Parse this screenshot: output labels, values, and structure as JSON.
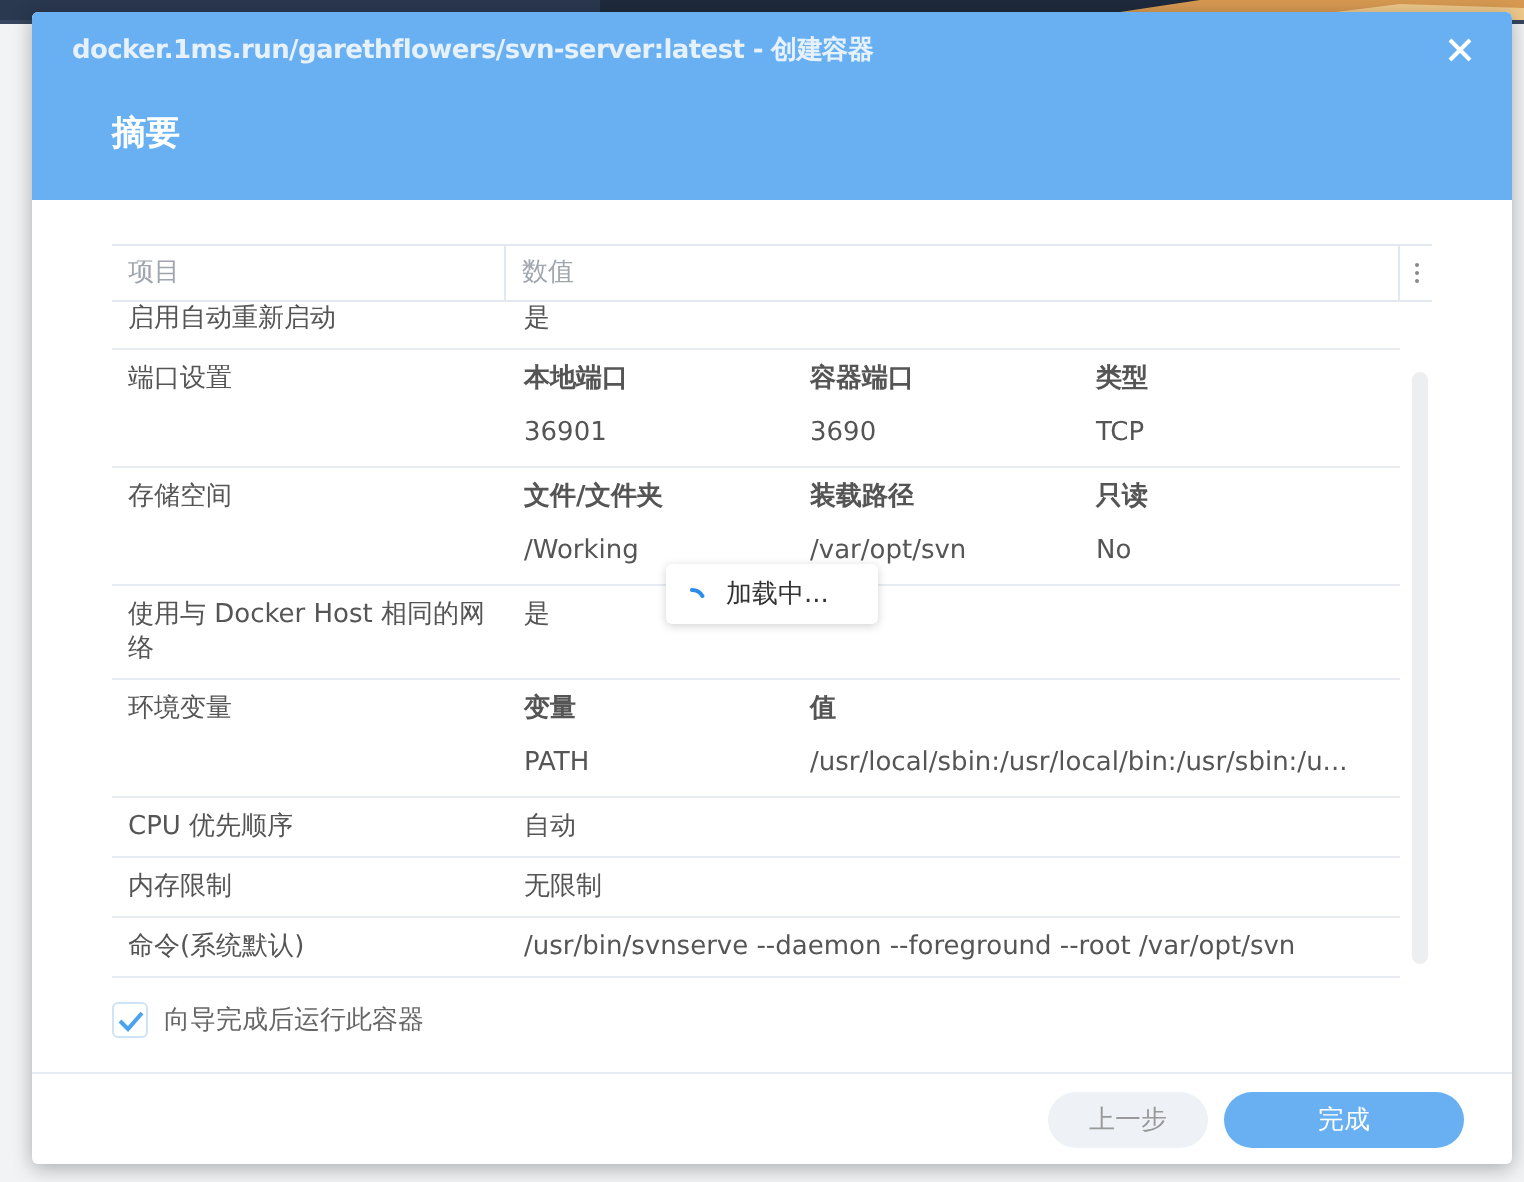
{
  "dialog": {
    "title": "docker.1ms.run/garethflowers/svn-server:latest - 创建容器",
    "heading": "摘要"
  },
  "table": {
    "columns": [
      "项目",
      "数值"
    ],
    "rows": [
      {
        "kind": "text",
        "label": "启用自动重新启动",
        "value": "是"
      },
      {
        "kind": "subtable",
        "label": "端口设置",
        "columns": [
          "本地端口",
          "容器端口",
          "类型"
        ],
        "rows": [
          [
            "36901",
            "3690",
            "TCP"
          ]
        ]
      },
      {
        "kind": "subtable",
        "label": "存储空间",
        "columns": [
          "文件/文件夹",
          "装载路径",
          "只读"
        ],
        "rows": [
          [
            "/Working",
            "/var/opt/svn",
            "No"
          ]
        ]
      },
      {
        "kind": "text",
        "label": "使用与 Docker Host 相同的网络",
        "value": "是"
      },
      {
        "kind": "subtable",
        "label": "环境变量",
        "columns": [
          "变量",
          "值"
        ],
        "rows": [
          [
            "PATH",
            "/usr/local/sbin:/usr/local/bin:/usr/sbin:/u..."
          ]
        ]
      },
      {
        "kind": "text",
        "label": "CPU 优先顺序",
        "value": "自动"
      },
      {
        "kind": "text",
        "label": "内存限制",
        "value": "无限制"
      },
      {
        "kind": "text",
        "label": "命令(系统默认)",
        "value": "/usr/bin/svnserve --daemon --foreground --root /var/opt/svn"
      }
    ]
  },
  "loading": {
    "text": "加载中..."
  },
  "run_after": {
    "label": "向导完成后运行此容器",
    "checked": true
  },
  "buttons": [
    {
      "label": "上一步",
      "kind": "secondary"
    },
    {
      "label": "完成",
      "kind": "primary"
    }
  ]
}
